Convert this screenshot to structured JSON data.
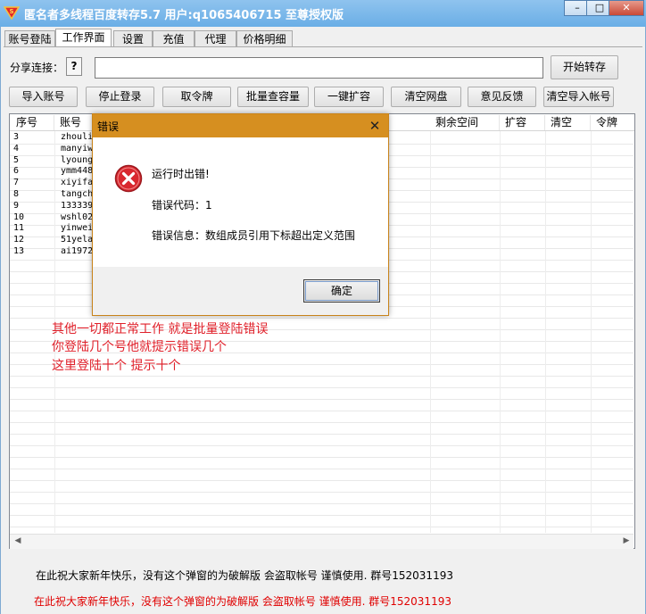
{
  "window": {
    "title": "匿名者多线程百度转存5.7 用户:q1065406715 至尊授权版",
    "min_symbol": "–",
    "max_symbol": "□",
    "close_symbol": "✕"
  },
  "tabs": [
    {
      "label": "账号登陆",
      "active": false
    },
    {
      "label": "工作界面",
      "active": true
    },
    {
      "label": "设置",
      "active": false
    },
    {
      "label": "充值",
      "active": false
    },
    {
      "label": "代理",
      "active": false
    },
    {
      "label": "价格明细",
      "active": false
    }
  ],
  "share": {
    "label": "分享连接：",
    "help_label": "?",
    "input_value": "",
    "start_button": "开始转存"
  },
  "toolbar": [
    "导入账号",
    "停止登录",
    "取令牌",
    "批量查容量",
    "一键扩容",
    "清空网盘",
    "意见反馈",
    "清空导入帐号"
  ],
  "table": {
    "columns": [
      "序号",
      "账号",
      "剩余空间",
      "扩容",
      "清空",
      "令牌"
    ],
    "rows": [
      {
        "index": "3",
        "account": "zhouli"
      },
      {
        "index": "4",
        "account": "manyiw"
      },
      {
        "index": "5",
        "account": "lyoung"
      },
      {
        "index": "6",
        "account": "ymm448"
      },
      {
        "index": "7",
        "account": "xiyifa"
      },
      {
        "index": "8",
        "account": "tangch"
      },
      {
        "index": "9",
        "account": "133339"
      },
      {
        "index": "10",
        "account": "wshl02"
      },
      {
        "index": "11",
        "account": "yinwei"
      },
      {
        "index": "12",
        "account": "51yela"
      },
      {
        "index": "13",
        "account": "ai1972"
      }
    ]
  },
  "notes": [
    "其他一切都正常工作 就是批量登陆错误",
    "你登陆几个号他就提示错误几个",
    "这里登陆十个   提示十个"
  ],
  "dialog": {
    "title": "错误",
    "close_symbol": "✕",
    "line1": "运行时出错!",
    "line2": "错误代码：1",
    "line3": "错误信息：数组成员引用下标超出定义范围",
    "ok_button": "确定"
  },
  "footer": {
    "line1": "在此祝大家新年快乐，没有这个弹窗的为破解版 会盗取帐号 谨慎使用. 群号152031193",
    "line2": "在此祝大家新年快乐，没有这个弹窗的为破解版 会盗取帐号 谨慎使用. 群号152031193"
  },
  "colors": {
    "titlebar": "#6aaee6",
    "dialog_title": "#d68f20",
    "note_red": "#e0202a",
    "footer_red": "#e00000",
    "error_icon": "#d9282f"
  }
}
